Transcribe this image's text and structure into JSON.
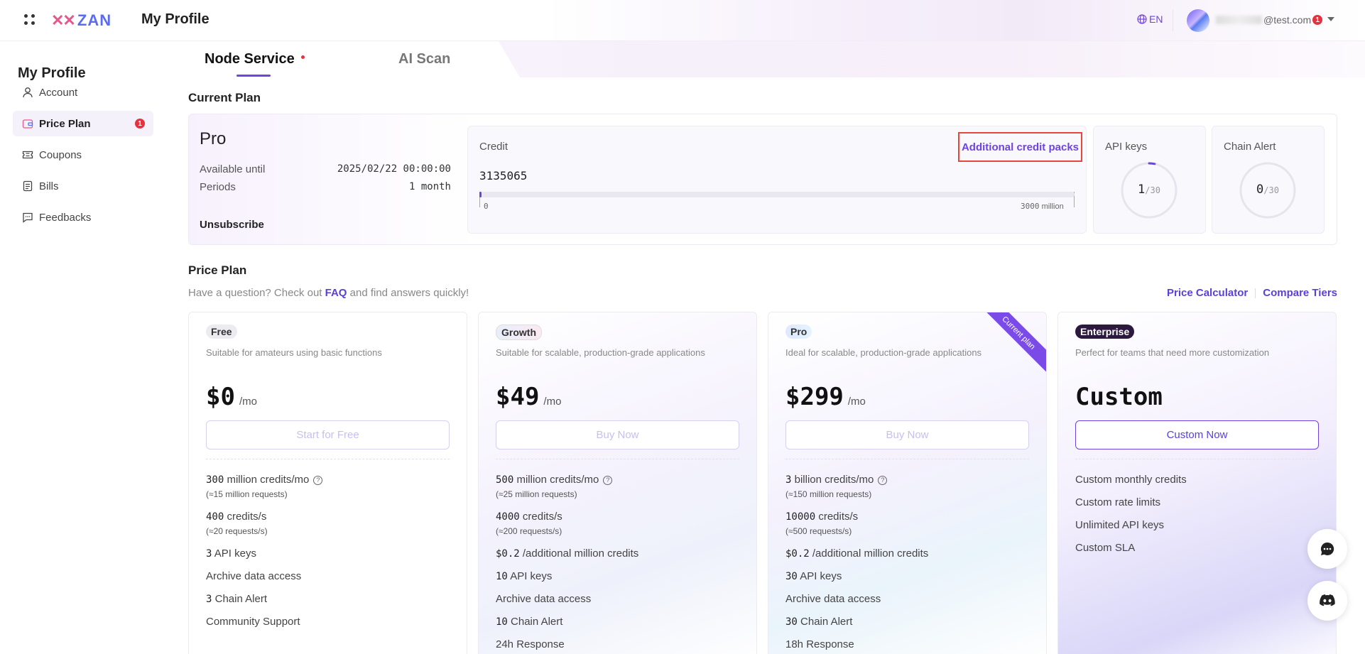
{
  "header": {
    "logo_text": "ZAN",
    "title": "My Profile",
    "language": "EN",
    "email_suffix": "@test.com",
    "notification_count": "1"
  },
  "sidebar": {
    "title": "My Profile",
    "items": [
      {
        "label": "Account",
        "icon": "user-icon"
      },
      {
        "label": "Price Plan",
        "icon": "wallet-icon",
        "badge": "1"
      },
      {
        "label": "Coupons",
        "icon": "ticket-icon"
      },
      {
        "label": "Bills",
        "icon": "document-icon"
      },
      {
        "label": "Feedbacks",
        "icon": "message-icon"
      }
    ]
  },
  "tabs": [
    {
      "label": "Node Service"
    },
    {
      "label": "AI Scan"
    }
  ],
  "current_plan": {
    "section_title": "Current Plan",
    "name": "Pro",
    "available_label": "Available until",
    "available_value": "2025/02/22 00:00:00",
    "periods_label": "Periods",
    "periods_value": "1 month",
    "unsubscribe_label": "Unsubscribe",
    "credit_label": "Credit",
    "credit_link": "Additional credit packs",
    "credit_value": "3135065",
    "credit_fraction": 0.001,
    "bar_min": "0",
    "bar_max": "3000",
    "bar_unit": "million",
    "api_keys_label": "API keys",
    "api_keys_used": "1",
    "api_keys_total": "/30",
    "api_keys_fraction": 0.033,
    "chain_alert_label": "Chain Alert",
    "chain_alert_used": "0",
    "chain_alert_total": "/30",
    "chain_alert_fraction": 0
  },
  "price_plan": {
    "section_title": "Price Plan",
    "sub_before": "Have a question? Check out ",
    "faq_link": "FAQ",
    "sub_after": " and find answers quickly!",
    "price_calculator": "Price Calculator",
    "compare_tiers": "Compare Tiers",
    "tiers": [
      {
        "badge": "Free",
        "desc": "Suitable for amateurs using basic functions",
        "price": "$0",
        "per": "/mo",
        "button": "Start for Free",
        "f1_num": "300",
        "f1_text": "million credits/mo",
        "f1_sub": "(≈15 million requests)",
        "f2_num": "400",
        "f2_text": "credits/s",
        "f2_sub": "(≈20 requests/s)",
        "f3_num": "3",
        "f3_text": "API keys",
        "f4_text": "Archive data access",
        "f5_num": "3",
        "f5_text": "Chain Alert",
        "f6_text": "Community Support"
      },
      {
        "badge": "Growth",
        "desc": "Suitable for scalable, production-grade applications",
        "price": "$49",
        "per": "/mo",
        "button": "Buy Now",
        "f1_num": "500",
        "f1_text": "million credits/mo",
        "f1_sub": "(≈25 million requests)",
        "f2_num": "4000",
        "f2_text": "credits/s",
        "f2_sub": "(≈200 requests/s)",
        "f3_num": "$0.2",
        "f3_text": "/additional million credits",
        "f4_num": "10",
        "f4_text": "API keys",
        "f5_text": "Archive data access",
        "f6_num": "10",
        "f6_text": "Chain Alert",
        "f7_text": "24h Response"
      },
      {
        "badge": "Pro",
        "desc": "Ideal for scalable, production-grade applications",
        "price": "$299",
        "per": "/mo",
        "button": "Buy Now",
        "ribbon": "Current plan",
        "f1_num": "3",
        "f1_text": "billion credits/mo",
        "f1_sub": "(≈150 million requests)",
        "f2_num": "10000",
        "f2_text": "credits/s",
        "f2_sub": "(≈500 requests/s)",
        "f3_num": "$0.2",
        "f3_text": "/additional million credits",
        "f4_num": "30",
        "f4_text": "API keys",
        "f5_text": "Archive data access",
        "f6_num": "30",
        "f6_text": "Chain Alert",
        "f7_text": "18h Response"
      },
      {
        "badge": "Enterprise",
        "desc": "Perfect for teams that need more customization",
        "price": "Custom",
        "button": "Custom Now",
        "f1_text": "Custom monthly credits",
        "f2_text": "Custom rate limits",
        "f3_text": "Unlimited API keys",
        "f4_text": "Custom SLA"
      }
    ]
  },
  "fab": {
    "chat_icon": "chat-icon",
    "discord_icon": "discord-icon"
  }
}
